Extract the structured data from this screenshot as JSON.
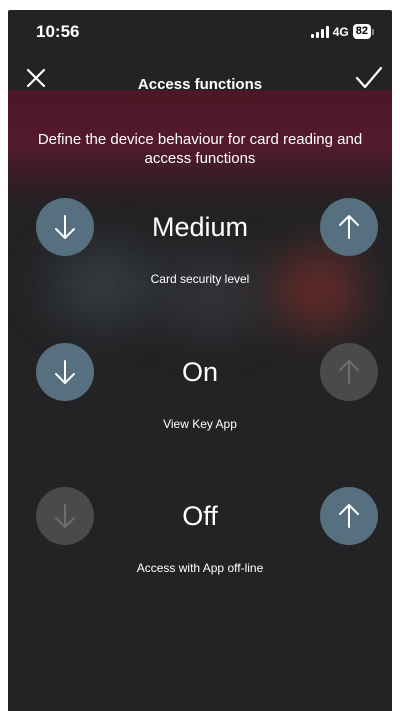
{
  "status_bar": {
    "time": "10:56",
    "network": "4G",
    "battery": "82"
  },
  "nav": {
    "title": "Access functions",
    "close_icon": "close-icon",
    "confirm_icon": "checkmark-icon"
  },
  "description": "Define the device behaviour for card reading and access functions",
  "settings": [
    {
      "value": "Medium",
      "label": "Card security level",
      "decrease_enabled": true,
      "increase_enabled": true
    },
    {
      "value": "On",
      "label": "View Key App",
      "decrease_enabled": true,
      "increase_enabled": false
    },
    {
      "value": "Off",
      "label": "Access with App off-line",
      "decrease_enabled": false,
      "increase_enabled": true
    }
  ],
  "colors": {
    "background": "#232325",
    "active_button": "#56707f",
    "inactive_button": "#4a4a4c",
    "header_tint": "#5c182c"
  }
}
